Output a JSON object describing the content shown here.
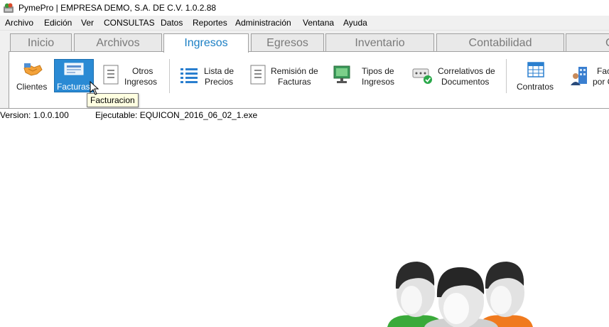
{
  "window": {
    "title": "PymePro | EMPRESA DEMO, S.A. DE C.V. 1.0.2.88"
  },
  "menu": [
    "Archivo",
    "Edición",
    "Ver",
    "CONSULTAS",
    "Datos",
    "Reportes",
    "Administración",
    "Ventana",
    "Ayuda"
  ],
  "tabs": [
    {
      "label": "Inicio"
    },
    {
      "label": "Archivos"
    },
    {
      "label": "Ingresos"
    },
    {
      "label": "Egresos"
    },
    {
      "label": "Inventario"
    },
    {
      "label": "Contabilidad"
    },
    {
      "label": "C"
    }
  ],
  "active_tab": "Ingresos",
  "ribbon": {
    "clientes": "Clientes",
    "facturas": "Facturas",
    "otros_1": "Otros",
    "otros_2": "Ingresos",
    "lista_1": "Lista de",
    "lista_2": "Precios",
    "remision_1": "Remisión de",
    "remision_2": "Facturas",
    "tipos_1": "Tipos de",
    "tipos_2": "Ingresos",
    "correl_1": "Correlativos de",
    "correl_2": "Documentos",
    "contratos": "Contratos",
    "fac_1": "Fac",
    "fac_2": "por C"
  },
  "tooltip": "Facturacion",
  "status": {
    "version": "Version: 1.0.0.100",
    "executable": "Ejecutable: EQUICON_2016_06_02_1.exe"
  },
  "colors": {
    "accent": "#1b7fc4",
    "selected_button": "#2a8ad4",
    "tooltip_bg": "#ffffe1"
  }
}
